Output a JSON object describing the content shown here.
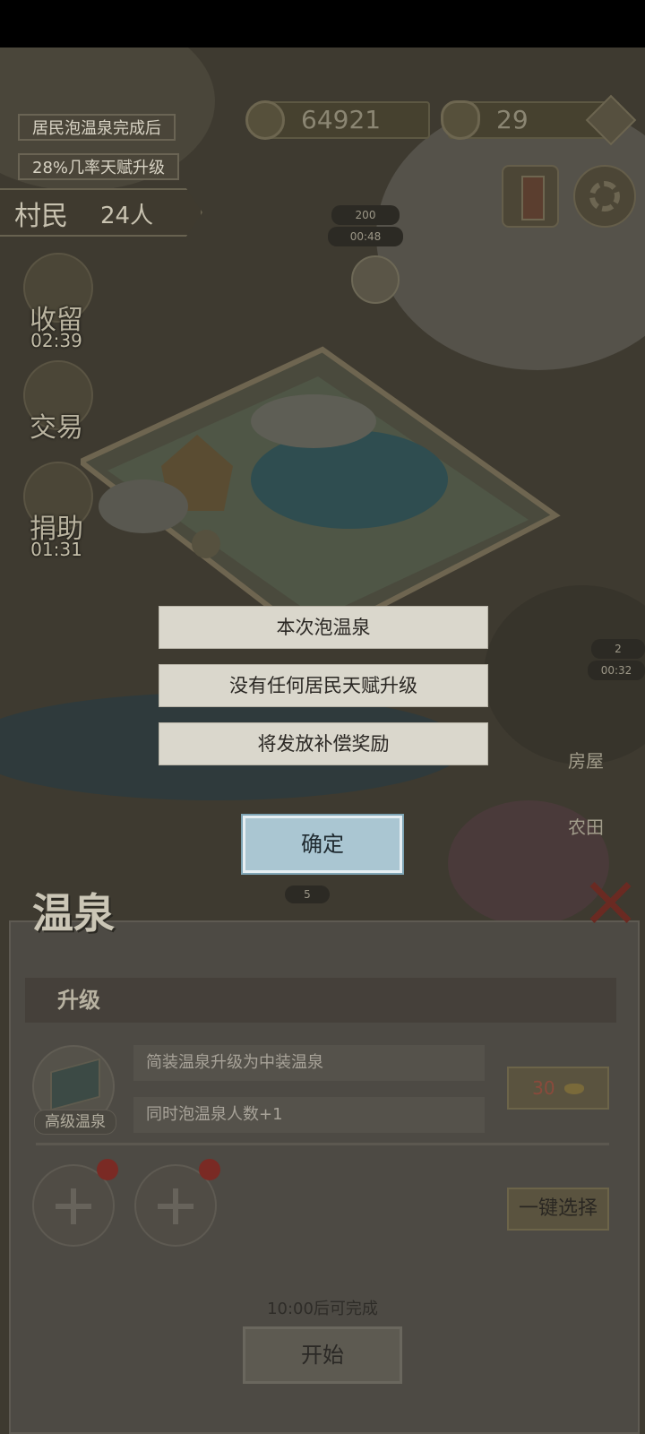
{
  "hud": {
    "event_line1": "居民泡温泉完成后",
    "event_line2": "28%几率天赋升级",
    "copper": "64921",
    "gold": "29",
    "villager_label": "村民",
    "villager_count": "24人"
  },
  "side_buttons": [
    {
      "label": "收留",
      "timer": "02:39"
    },
    {
      "label": "交易",
      "timer": ""
    },
    {
      "label": "捐助",
      "timer": "01:31"
    }
  ],
  "map_labels": {
    "top_counter": "200",
    "top_timer": "00:48",
    "right_counter": "2",
    "right_timer": "00:32",
    "bottom_counter": "5",
    "house_label": "房屋",
    "farm_label": "农田"
  },
  "dialog": {
    "line1": "本次泡温泉",
    "line2": "没有任何居民天赋升级",
    "line3": "将发放补偿奖励",
    "confirm": "确定"
  },
  "panel": {
    "title": "温泉",
    "section": "升级",
    "item_label": "高级温泉",
    "desc1": "简装温泉升级为中装温泉",
    "desc2": "同时泡温泉人数+1",
    "cost": "30",
    "one_click_select": "一键选择",
    "time_hint": "10:00后可完成",
    "start": "开始"
  },
  "colors": {
    "dialog_bg": "#dad7cc",
    "confirm_bg": "#aac6d2",
    "overlay_panel": "#4d4a44"
  }
}
